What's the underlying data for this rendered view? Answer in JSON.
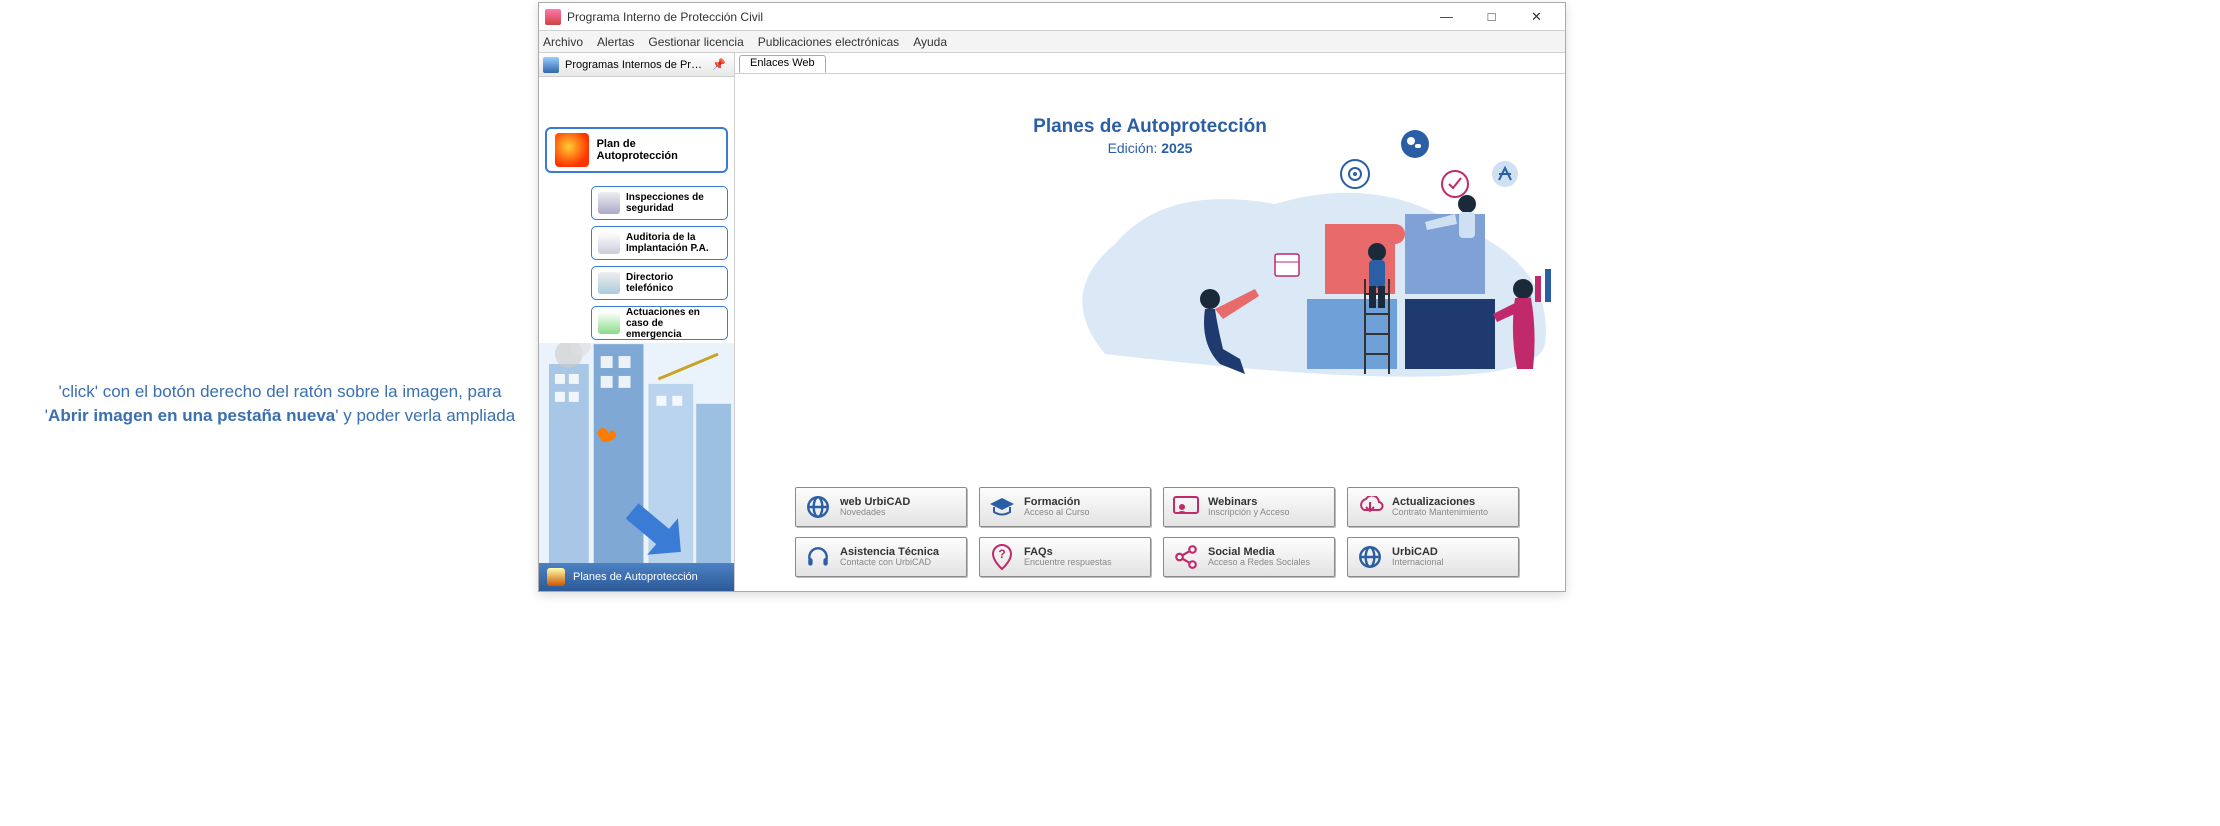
{
  "annotation": {
    "line1_a": "'click' con el botón derecho del ratón sobre la imagen, para",
    "line2_a": "'",
    "line2_b": "Abrir imagen en una pestaña nueva",
    "line2_c": "' y poder verla ampliada"
  },
  "window": {
    "title": "Programa Interno de Protección Civil"
  },
  "menu": {
    "archivo": "Archivo",
    "alertas": "Alertas",
    "gestionar": "Gestionar licencia",
    "publicaciones": "Publicaciones electrónicas",
    "ayuda": "Ayuda"
  },
  "sidebar": {
    "header": "Programas Internos de Protección..",
    "main_btn": "Plan de Autoprotección",
    "items": [
      {
        "label": "Inspecciones de seguridad"
      },
      {
        "label": "Auditoria de la Implantación P.A."
      },
      {
        "label": "Directorio telefónico"
      },
      {
        "label": "Actuaciones en caso de emergencia"
      }
    ],
    "footer": "Planes de Autoprotección"
  },
  "main": {
    "tab": "Enlaces Web",
    "hero_title": "Planes de Autoprotección",
    "hero_sub_a": "Edición: ",
    "hero_sub_b": "2025"
  },
  "buttons": [
    {
      "title": "web UrbiCAD",
      "sub": "Novedades",
      "color": "#2a5fa5"
    },
    {
      "title": "Formación",
      "sub": "Acceso al Curso",
      "color": "#2a5fa5"
    },
    {
      "title": "Webinars",
      "sub": "Inscripción y Acceso",
      "color": "#c02a6b"
    },
    {
      "title": "Actualizaciones",
      "sub": "Contrato Mantenimiento",
      "color": "#c02a6b"
    },
    {
      "title": "Asistencia Técnica",
      "sub": "Contacte con UrbiCAD",
      "color": "#2a5fa5"
    },
    {
      "title": "FAQs",
      "sub": "Encuentre respuestas",
      "color": "#c02a6b"
    },
    {
      "title": "Social Media",
      "sub": "Acceso a Redes Sociales",
      "color": "#c02a6b"
    },
    {
      "title": "UrbiCAD",
      "sub": "Internacional",
      "color": "#2a5fa5"
    }
  ]
}
